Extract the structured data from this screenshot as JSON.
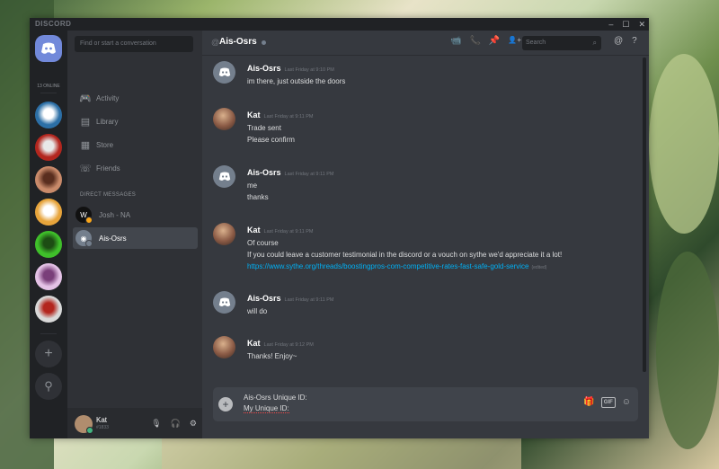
{
  "app": {
    "brand": "DISCORD",
    "window_controls": [
      "–",
      "☐",
      "✕"
    ]
  },
  "guilds": {
    "online_count": "13 ONLINE",
    "servers": [
      {
        "color": "#2c6fa6",
        "accent": "#ffffff"
      },
      {
        "color": "#b3261e",
        "accent": "#e8e8e8"
      },
      {
        "color": "#c98a6a",
        "accent": "#5a2e1f"
      },
      {
        "color": "#e7a43b",
        "accent": "#ffffff"
      },
      {
        "color": "#3fbf2a",
        "accent": "#1d4d14"
      },
      {
        "color": "#e4c2e6",
        "accent": "#7a3f7a"
      },
      {
        "color": "#d9d9d9",
        "accent": "#b3261e"
      }
    ],
    "add_icon": "+",
    "search_icon": "⚲"
  },
  "channels": {
    "search_placeholder": "Find or start a conversation",
    "nav": [
      {
        "label": "Activity",
        "icon": "🎮"
      },
      {
        "label": "Library",
        "icon": "▤"
      },
      {
        "label": "Store",
        "icon": "▦"
      },
      {
        "label": "Friends",
        "icon": "☏"
      }
    ],
    "dm_header": "DIRECT MESSAGES",
    "dms": [
      {
        "label": "Josh - NA",
        "avatar_color": "#111111",
        "glyph": "W",
        "status_color": "#faa61a",
        "active": false
      },
      {
        "label": "Ais-Osrs",
        "avatar_color": "#747f8d",
        "glyph": "◉",
        "status_color": "#747f8d",
        "active": true
      }
    ]
  },
  "user": {
    "name": "Kat",
    "tag": "#1833",
    "controls": [
      "🎙",
      "🎧",
      "⚙"
    ]
  },
  "header": {
    "at": "@",
    "name": "Ais-Osrs",
    "search_placeholder": "Search",
    "search_icon": "⌕",
    "tools": [
      "📹",
      "📞",
      "📌",
      "👤+"
    ],
    "right": [
      "@",
      "?"
    ]
  },
  "messages": [
    {
      "author": "Ais-Osrs",
      "time": "Last Friday at 9:10 PM",
      "avatar": "bot",
      "lines": [
        "im there, just outside the doors"
      ]
    },
    {
      "author": "Kat",
      "time": "Last Friday at 9:11 PM",
      "avatar": "kat",
      "lines": [
        "Trade sent",
        "Please confirm"
      ]
    },
    {
      "author": "Ais-Osrs",
      "time": "Last Friday at 9:11 PM",
      "avatar": "bot",
      "lines": [
        "me",
        "thanks"
      ]
    },
    {
      "author": "Kat",
      "time": "Last Friday at 9:11 PM",
      "avatar": "kat",
      "lines": [
        "Of course",
        "If you could leave a customer testimonial in the discord or a vouch on sythe we'd appreciate it a lot!"
      ],
      "link": "https://www.sythe.org/threads/boostingpros-com-competitive-rates-fast-safe-gold-service",
      "edited": "(edited)"
    },
    {
      "author": "Ais-Osrs",
      "time": "Last Friday at 9:11 PM",
      "avatar": "bot",
      "lines": [
        "will do"
      ]
    },
    {
      "author": "Kat",
      "time": "Last Friday at 9:12 PM",
      "avatar": "kat",
      "lines": [
        "Thanks! Enjoy~"
      ]
    }
  ],
  "composer": {
    "line1": "Ais-Osrs Unique ID:",
    "line2": "My Unique ID:",
    "tools": [
      "🎁",
      "GIF",
      "☺"
    ]
  }
}
